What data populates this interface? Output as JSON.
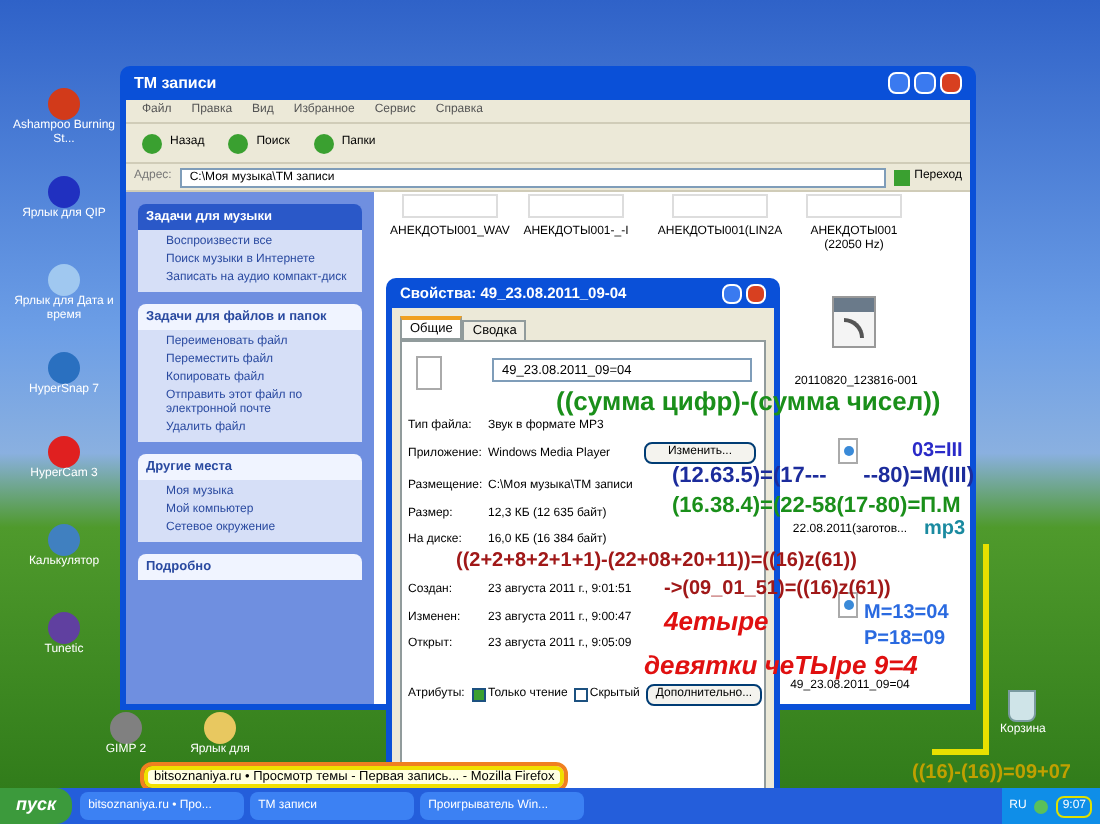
{
  "desktop_icons": [
    {
      "label": "Ashampoo Burning St..."
    },
    {
      "label": "Ярлык для QIP"
    },
    {
      "label": "Ярлык для Дата и время"
    },
    {
      "label": "HyperSnap 7"
    },
    {
      "label": "HyperCam 3"
    },
    {
      "label": "Калькулятор"
    },
    {
      "label": "Tunetic"
    },
    {
      "label": "GIMP 2"
    },
    {
      "label": "Ярлык для"
    }
  ],
  "recycle_bin": {
    "label": "Корзина"
  },
  "explorer": {
    "title": "TM записи",
    "menu": [
      "Файл",
      "Правка",
      "Вид",
      "Избранное",
      "Сервис",
      "Справка"
    ],
    "toolbar": [
      "Назад",
      "Поиск",
      "Папки"
    ],
    "address_label": "Адрес:",
    "address": "C:\\Моя музыка\\TM записи",
    "go_button": "Переход",
    "task_panels": [
      {
        "title": "Задачи для музыки",
        "items": [
          "Воспроизвести все",
          "Поиск музыки в Интернете",
          "Записать на аудио компакт-диск"
        ]
      },
      {
        "title": "Задачи для файлов и папок",
        "items": [
          "Переименовать файл",
          "Переместить файл",
          "Копировать файл",
          "Отправить этот файл по электронной почте",
          "Удалить файл"
        ]
      },
      {
        "title": "Другие места",
        "items": [
          "Моя музыка",
          "Мой компьютер",
          "Сетевое окружение"
        ]
      },
      {
        "title": "Подробно"
      }
    ],
    "files": [
      {
        "name": "АНЕКДОТЫ001_WAV",
        "kind": "blank"
      },
      {
        "name": "АНЕКДОТЫ001-_-I",
        "kind": "blank"
      },
      {
        "name": "АНЕКДОТЫ001(LIN2A",
        "kind": "blank"
      },
      {
        "name": "АНЕКДОТЫ001 (22050 Hz)",
        "kind": "blank"
      },
      {
        "name": "20110820_123816-001",
        "kind": "wav"
      },
      {
        "name": "22.08.2011(заготов...",
        "kind": "mp3"
      },
      {
        "name": "49_23.08.2011_09=04",
        "kind": "mp3"
      }
    ]
  },
  "properties": {
    "title": "Свойства: 49_23.08.2011_09-04",
    "tabs": [
      {
        "label": "Общие",
        "selected": true
      },
      {
        "label": "Сводка",
        "selected": false
      }
    ],
    "file_name": "49_23.08.2011_09=04",
    "rows": [
      {
        "label": "Тип файла:",
        "value": "Звук в формате MP3"
      },
      {
        "label": "Приложение:",
        "value": "Windows Media Player"
      },
      {
        "label": "Размещение:",
        "value": "C:\\Моя музыка\\TM записи"
      },
      {
        "label": "Размер:",
        "value": "12,3 КБ (12 635 байт)"
      },
      {
        "label": "На диске:",
        "value": "16,0 КБ (16 384 байт)"
      },
      {
        "label": "Создан:",
        "value": "23 августа 2011 г., 9:01:51"
      },
      {
        "label": "Изменен:",
        "value": "23 августа 2011 г., 9:00:47"
      },
      {
        "label": "Открыт:",
        "value": "23 августа 2011 г., 9:05:09"
      }
    ],
    "change_button": "Изменить...",
    "attributes_label": "Атрибуты:",
    "attributes": [
      {
        "label": "Только чтение",
        "checked": true
      },
      {
        "label": "Скрытый",
        "checked": false
      }
    ],
    "advanced_button": "Дополнительно..."
  },
  "annotations": [
    {
      "text": "((сумма цифр)-(сумма чисел))",
      "color": "#1a8f1a"
    },
    {
      "text": "03=III",
      "color": "#2a2ac8"
    },
    {
      "text": "(12.63.5)=(17---      --80)=M(III)",
      "color": "#1c2c9c"
    },
    {
      "text": "(16.38.4)=(22-58(17-80)=П.М",
      "color": "#1a8f1a"
    },
    {
      "text": "mp3",
      "color": "#1a8aa0"
    },
    {
      "text": "((2+2+8+2+1+1)-(22+08+20+11))=((16)z(61))",
      "color": "#a01818"
    },
    {
      "text": "->(09_01_51)=((16)z(61))",
      "color": "#a01818"
    },
    {
      "text": "M=13=04",
      "color": "#2a6ae0"
    },
    {
      "text": "P=18=09",
      "color": "#2a6ae0"
    },
    {
      "text": "4етыре",
      "color": "#e01010"
    },
    {
      "text": "девятки чеТЫре 9=4",
      "color": "#e01010"
    },
    {
      "text": "((16)-(16))=09+07",
      "color": "#c0a000"
    }
  ],
  "firefox_tooltip": "bitsoznaniya.ru • Просмотр темы - Первая запись... - Mozilla Firefox",
  "taskbar": {
    "start": "пуск",
    "tasks": [
      {
        "label": "bitsoznaniya.ru • Про...",
        "selected": false
      },
      {
        "label": "TM записи",
        "selected": false
      },
      {
        "label": "Проигрыватель Win...",
        "selected": false
      }
    ],
    "lang": "RU",
    "clock": "9:07"
  }
}
